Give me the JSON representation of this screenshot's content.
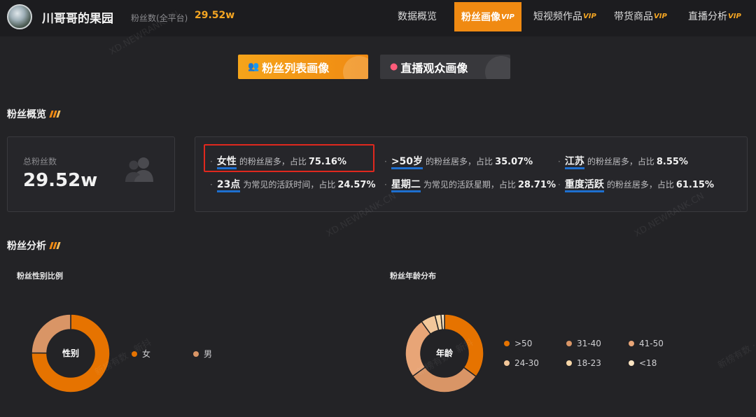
{
  "header": {
    "account_name": "川哥哥的果园",
    "fans_label": "粉丝数(全平台)",
    "fans_value": "29.52w",
    "nav": [
      {
        "label": "数据概览",
        "vip": ""
      },
      {
        "label": "粉丝画像",
        "vip": "VIP"
      },
      {
        "label": "短视频作品",
        "vip": "VIP"
      },
      {
        "label": "带货商品",
        "vip": "VIP"
      },
      {
        "label": "直播分析",
        "vip": "VIP"
      }
    ],
    "active_nav": "粉丝画像"
  },
  "subtabs": [
    {
      "label": "粉丝列表画像",
      "icon": "fans-icon",
      "active": true
    },
    {
      "label": "直播观众画像",
      "icon": "viewer-icon",
      "active": false
    }
  ],
  "overview": {
    "title": "粉丝概览",
    "total_label": "总粉丝数",
    "total_value": "29.52w",
    "facts": [
      {
        "key": "女性",
        "text": "的粉丝居多，占比",
        "pct": "75.16%"
      },
      {
        "key": ">50岁",
        "text": "的粉丝居多，占比",
        "pct": "35.07%"
      },
      {
        "key": "江苏",
        "text": "的粉丝居多，占比",
        "pct": "8.55%"
      },
      {
        "key": "23点",
        "text": "为常见的活跃时间，占比",
        "pct": "24.57%"
      },
      {
        "key": "星期二",
        "text": "为常见的活跃星期，占比",
        "pct": "28.71%"
      },
      {
        "key": "重度活跃",
        "text": "的粉丝居多，占比",
        "pct": "61.15%"
      }
    ]
  },
  "analysis": {
    "title": "粉丝分析"
  },
  "watermarks": [
    "XD.NEWRANK.CN",
    "新榜有数 · 新抖"
  ],
  "colors": {
    "accent": "#f08a12",
    "highlight_border": "#e0281e",
    "key_underline": "#1e6fd0"
  },
  "chart_data": [
    {
      "type": "pie",
      "title": "粉丝性别比例",
      "center_label": "性别",
      "categories": [
        "女",
        "男"
      ],
      "values": [
        75.16,
        24.84
      ],
      "colors": [
        "#e67300",
        "#d99566"
      ]
    },
    {
      "type": "pie",
      "title": "粉丝年龄分布",
      "center_label": "年龄",
      "categories": [
        ">50",
        "31-40",
        "41-50",
        "24-30",
        "18-23",
        "<18"
      ],
      "values": [
        35.07,
        30,
        25,
        6,
        2.5,
        1.43
      ],
      "colors": [
        "#e67300",
        "#d99566",
        "#e8a577",
        "#f2c79a",
        "#f7d7a8",
        "#fae4c2"
      ]
    }
  ]
}
